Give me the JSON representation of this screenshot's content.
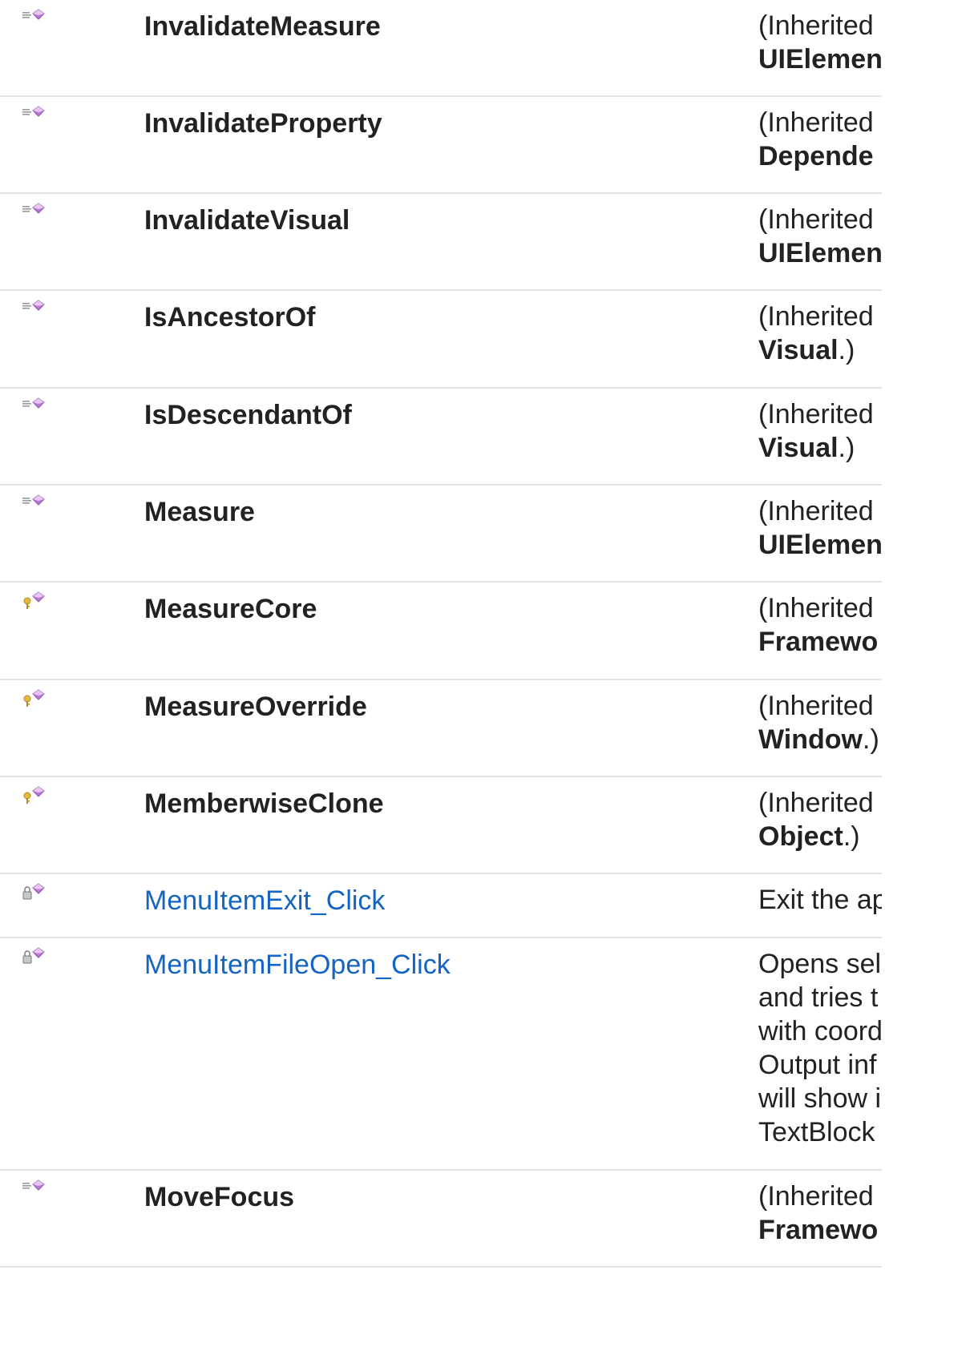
{
  "colors": {
    "link": "#1364c4",
    "text": "#222222",
    "divider": "#e3e3e3",
    "method_icon": "#b97ad6",
    "key_icon": "#e6b83a"
  },
  "rows": [
    {
      "icon": "public-method-icon",
      "name": "InvalidateMeasure",
      "link": false,
      "desc_prefix": "(Inherited",
      "desc_bold": "UIElemen",
      "desc_suffix": ""
    },
    {
      "icon": "public-method-icon",
      "name": "InvalidateProperty",
      "link": false,
      "desc_prefix": "(Inherited",
      "desc_bold": "Depende",
      "desc_suffix": ""
    },
    {
      "icon": "public-method-icon",
      "name": "InvalidateVisual",
      "link": false,
      "desc_prefix": "(Inherited",
      "desc_bold": "UIElemen",
      "desc_suffix": ""
    },
    {
      "icon": "public-method-icon",
      "name": "IsAncestorOf",
      "link": false,
      "desc_prefix": "(Inherited",
      "desc_bold": "Visual",
      "desc_suffix": ".)"
    },
    {
      "icon": "public-method-icon",
      "name": "IsDescendantOf",
      "link": false,
      "desc_prefix": "(Inherited",
      "desc_bold": "Visual",
      "desc_suffix": ".)"
    },
    {
      "icon": "public-method-icon",
      "name": "Measure",
      "link": false,
      "desc_prefix": "(Inherited",
      "desc_bold": "UIElemen",
      "desc_suffix": ""
    },
    {
      "icon": "protected-method-icon",
      "name": "MeasureCore",
      "link": false,
      "desc_prefix": "(Inherited",
      "desc_bold": "Framewo",
      "desc_suffix": ""
    },
    {
      "icon": "protected-method-icon",
      "name": "MeasureOverride",
      "link": false,
      "desc_prefix": "(Inherited",
      "desc_bold": "Window",
      "desc_suffix": ".)"
    },
    {
      "icon": "protected-method-icon",
      "name": "MemberwiseClone",
      "link": false,
      "desc_prefix": "(Inherited",
      "desc_bold": "Object",
      "desc_suffix": ".)"
    },
    {
      "icon": "private-method-icon",
      "name": "MenuItemExit_Click",
      "link": true,
      "desc_lines": [
        "Exit the ap"
      ]
    },
    {
      "icon": "private-method-icon",
      "name": "MenuItemFileOpen_Click",
      "link": true,
      "desc_lines": [
        "Opens sel",
        "and tries t",
        "with coord",
        "Output inf",
        "will show i",
        "TextBlock"
      ]
    },
    {
      "icon": "public-method-icon",
      "name": "MoveFocus",
      "link": false,
      "desc_prefix": "(Inherited",
      "desc_bold": "Framewo",
      "desc_suffix": ""
    }
  ]
}
